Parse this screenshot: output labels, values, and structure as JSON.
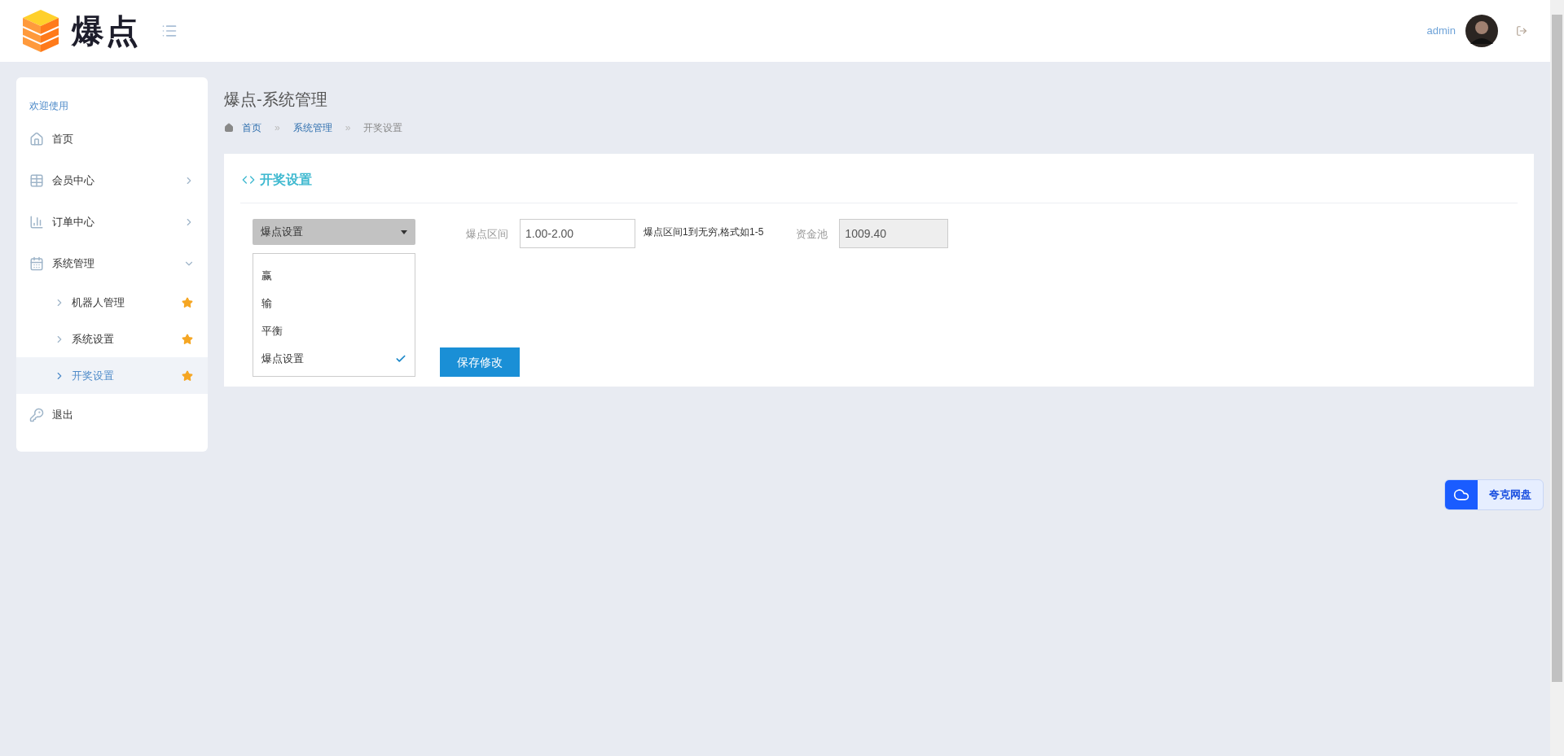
{
  "header": {
    "logo_text": "爆点",
    "user": "admin"
  },
  "sidebar": {
    "heading": "欢迎使用",
    "items": [
      {
        "label": "首页",
        "kind": "link"
      },
      {
        "label": "会员中心",
        "kind": "menu",
        "expanded": false
      },
      {
        "label": "订单中心",
        "kind": "menu",
        "expanded": false
      },
      {
        "label": "系统管理",
        "kind": "menu",
        "expanded": true,
        "children": [
          {
            "label": "机器人管理",
            "selected": false
          },
          {
            "label": "系统设置",
            "selected": false
          },
          {
            "label": "开奖设置",
            "selected": true
          }
        ]
      },
      {
        "label": "退出",
        "kind": "link"
      }
    ]
  },
  "page": {
    "title": "爆点-系统管理",
    "breadcrumb": [
      {
        "label": "首页",
        "link": true
      },
      {
        "separator": "»",
        "label": "系统管理",
        "link": true
      },
      {
        "separator": "»",
        "label": "开奖设置",
        "link": false
      }
    ]
  },
  "panel": {
    "title": "开奖设置",
    "select": {
      "value": "爆点设置",
      "expanded": true,
      "options": [
        {
          "label": "赢",
          "selected": false
        },
        {
          "label": "输",
          "selected": false
        },
        {
          "label": "平衡",
          "selected": false
        },
        {
          "label": "爆点设置",
          "selected": true
        }
      ]
    },
    "fields": [
      {
        "label": "爆点区间",
        "value": "1.00-2.00",
        "hint": "爆点区间1到无穷,格式如1-5",
        "disabled": false
      },
      {
        "label": "资金池",
        "value": "1009.40",
        "disabled": true
      }
    ],
    "save_button": "保存修改"
  },
  "cloud_widget": {
    "label": "夸克网盘"
  }
}
